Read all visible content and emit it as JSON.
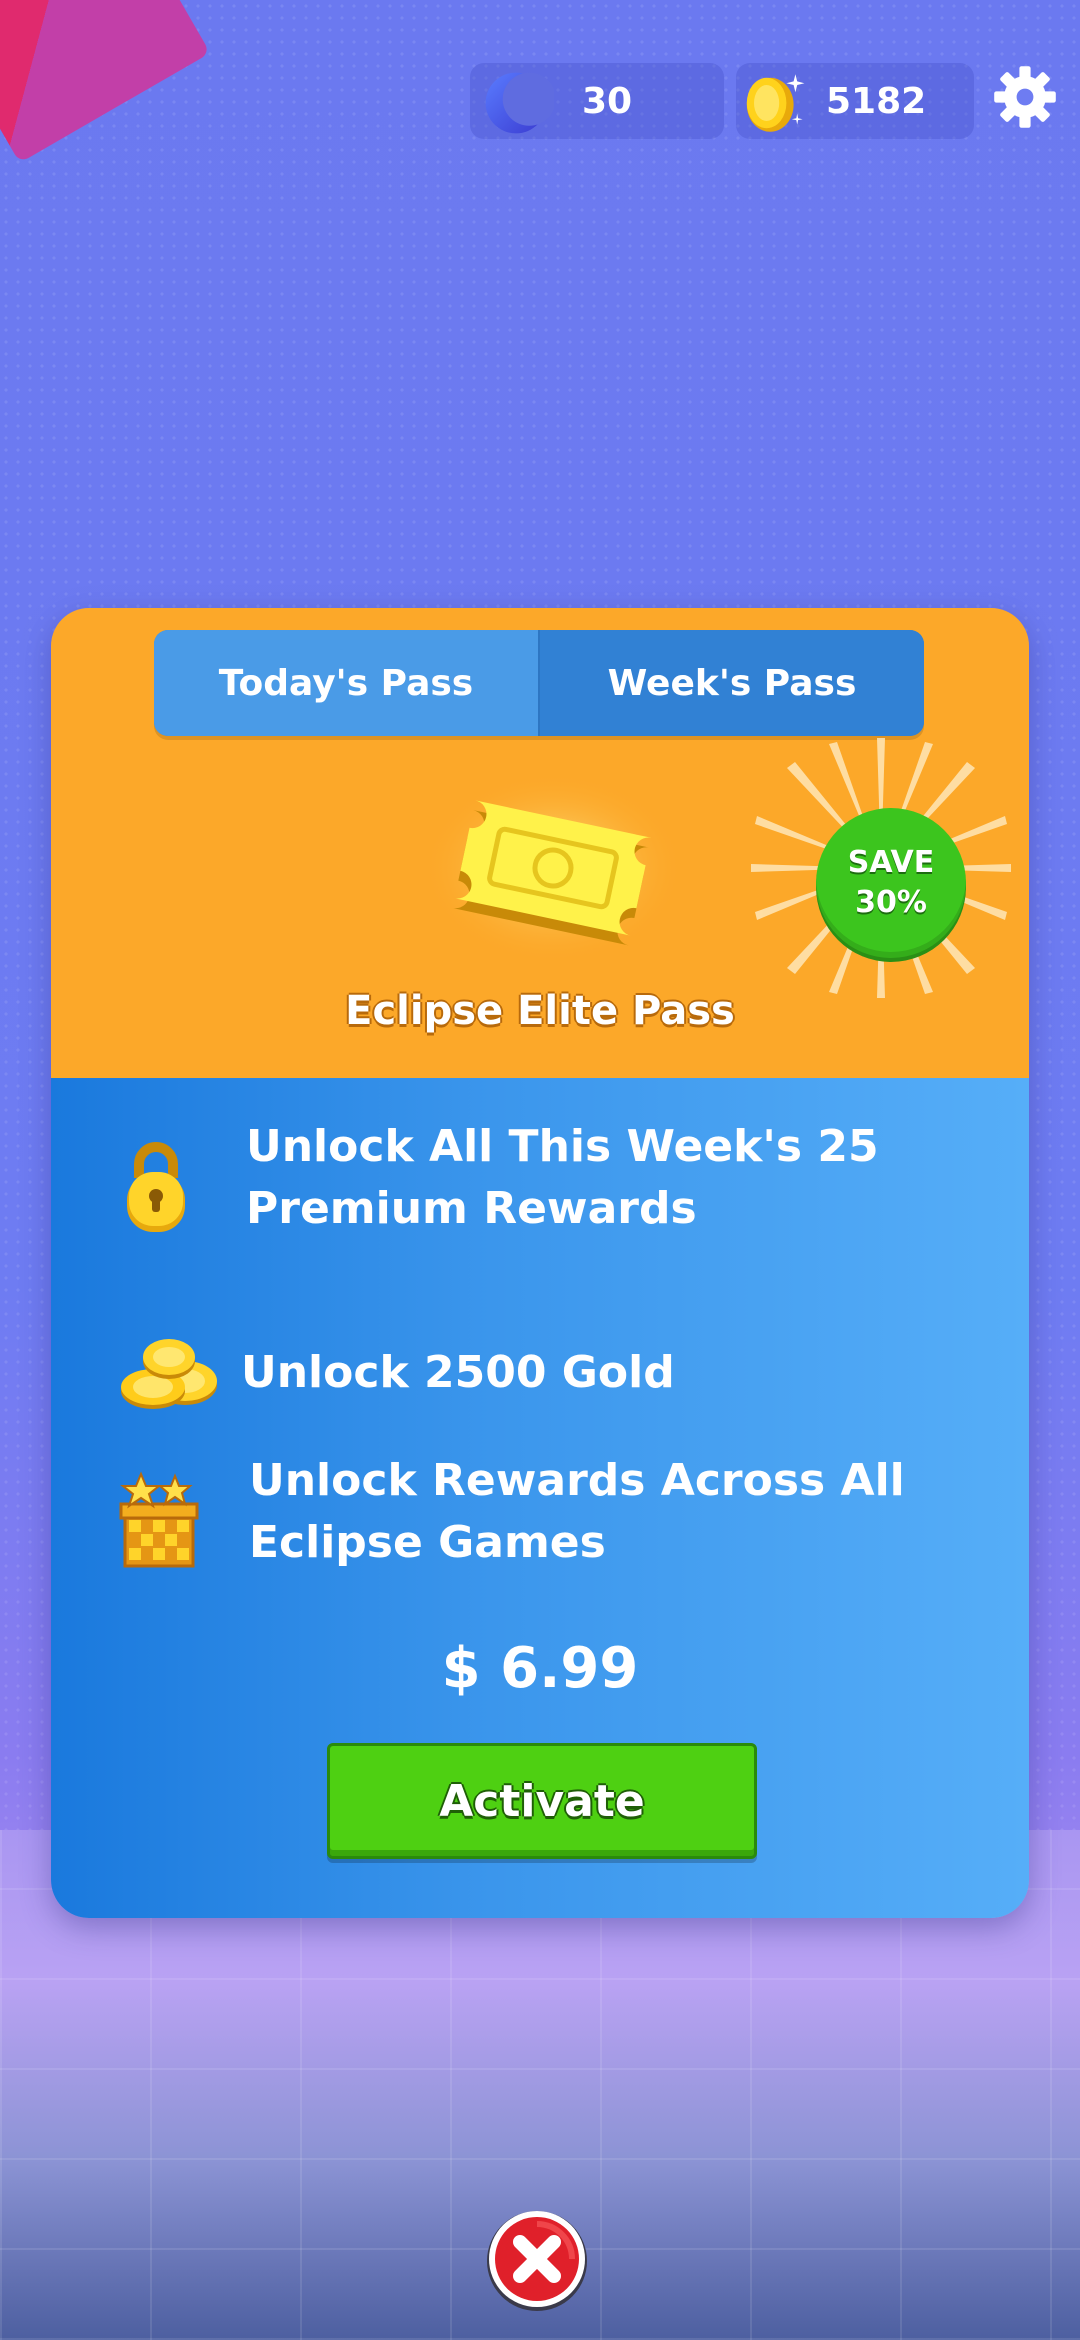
{
  "currency": {
    "moon_value": "30",
    "gold_value": "5182"
  },
  "tabs": [
    {
      "label": "Today's Pass",
      "active": true
    },
    {
      "label": "Week's Pass",
      "active": false
    }
  ],
  "pass": {
    "title": "Eclipse Elite Pass",
    "badge_line1": "SAVE",
    "badge_line2": "30%"
  },
  "features": [
    {
      "icon": "lock-icon",
      "line1": "Unlock All This Week's 25",
      "line2": "Premium Rewards"
    },
    {
      "icon": "gold-coins-icon",
      "line1": "Unlock 2500 Gold",
      "line2": ""
    },
    {
      "icon": "gift-box-icon",
      "line1": "Unlock Rewards Across All",
      "line2": "Eclipse Games"
    }
  ],
  "price": "$ 6.99",
  "activate_label": "Activate",
  "colors": {
    "card_top": "#fca829",
    "card_bottom": "#3b96ec",
    "activate": "#4ed012",
    "save_badge": "#3cc51e",
    "close": "#e0202a"
  }
}
